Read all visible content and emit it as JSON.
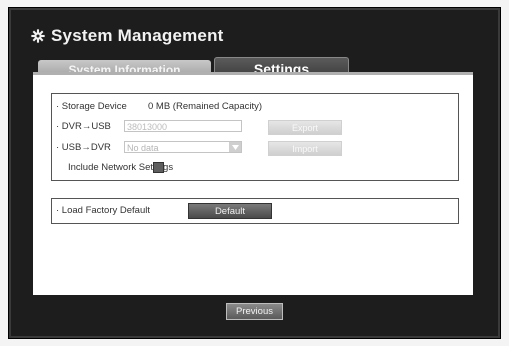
{
  "window": {
    "title": "System Management",
    "title_icon": "gear-icon"
  },
  "tabs": [
    {
      "label": "System Information",
      "active": false
    },
    {
      "label": "Settings",
      "active": true
    }
  ],
  "settings": {
    "storage_device_label": "· Storage Device",
    "storage_device_value": "0 MB (Remained Capacity)",
    "dvr_usb_label": "· DVR→USB",
    "dvr_usb_filename": "38013000",
    "export_label": "Export",
    "usb_dvr_label": "· USB→DVR",
    "usb_dvr_value": "No data",
    "import_label": "Import",
    "include_network_label": "Include Network Settings",
    "load_factory_label": "· Load Factory Default",
    "default_label": "Default"
  },
  "footer": {
    "previous_label": "Previous"
  },
  "colors": {
    "frame": "#1d1d1d",
    "panel": "#ffffff",
    "active_tab": "#4a4a4a",
    "inactive_tab": "#b5b5b5"
  }
}
